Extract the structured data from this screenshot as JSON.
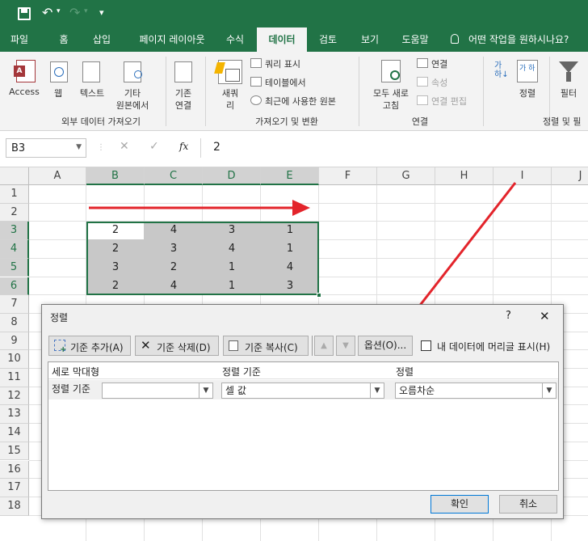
{
  "qat": {
    "customize": "▾"
  },
  "tabs": [
    "파일",
    "홈",
    "삽입",
    "페이지 레이아웃",
    "수식",
    "데이터",
    "검토",
    "보기",
    "도움말"
  ],
  "tell_me": "어떤 작업을 원하시나요?",
  "ribbon": {
    "access": "Access",
    "web": "웹",
    "text": "텍스트",
    "other_line1": "기타",
    "other_line2": "원본에서",
    "existing_line1": "기존",
    "existing_line2": "연결",
    "group1": "외부 데이터 가져오기",
    "new_query_line1": "새쿼",
    "new_query_line2": "리",
    "show_queries": "쿼리 표시",
    "from_table": "테이블에서",
    "recent_sources": "최근에 사용한 원본",
    "group2": "가져오기 및 변환",
    "refresh_line1": "모두 새로",
    "refresh_line2": "고침",
    "connections": "연결",
    "properties": "속성",
    "edit_links": "연결 편집",
    "group3": "연결",
    "sort": "정렬",
    "filter": "필터",
    "group4": "정렬 및 필"
  },
  "formula_bar": {
    "name_box": "B3",
    "fx": "fx",
    "value": "2"
  },
  "columns": [
    "A",
    "B",
    "C",
    "D",
    "E",
    "F",
    "G",
    "H",
    "I",
    "J"
  ],
  "rows": [
    "1",
    "2",
    "3",
    "4",
    "5",
    "6",
    "7",
    "8",
    "9",
    "10",
    "11",
    "12",
    "13",
    "14",
    "15",
    "16",
    "17",
    "18"
  ],
  "cells": [
    [
      "2",
      "4",
      "3",
      "1"
    ],
    [
      "2",
      "3",
      "4",
      "1"
    ],
    [
      "3",
      "2",
      "1",
      "4"
    ],
    [
      "2",
      "4",
      "1",
      "3"
    ]
  ],
  "dialog": {
    "title": "정렬",
    "help": "?",
    "close": "✕",
    "add_level": "기준 추가(A)",
    "delete_level": "기준 삭제(D)",
    "copy_level": "기준 복사(C)",
    "options": "옵션(O)...",
    "header_check": "내 데이터에 머리글 표시(H)",
    "col_header": "세로 막대형",
    "sort_on_header": "정렬 기준",
    "order_header": "정렬",
    "row_label": "정렬 기준",
    "column_value": "",
    "sort_on_value": "셀 값",
    "order_value": "오름차순",
    "ok": "확인",
    "cancel": "취소"
  },
  "colors": {
    "excel_green": "#217346",
    "arrow_red": "#e3242b",
    "selection_gray": "#c8c8c8"
  }
}
